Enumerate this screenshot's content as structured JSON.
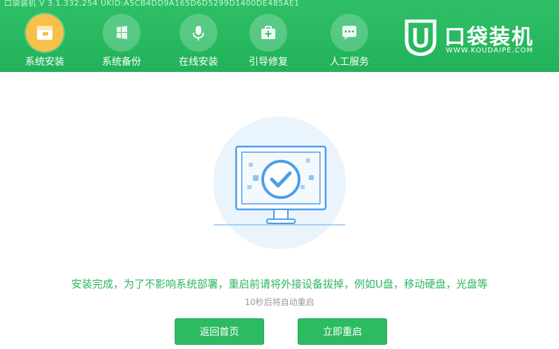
{
  "window": {
    "title": "口袋装机 V 3.1.332.254 UKID:A5CB4DD9A165D6D5299D1400DE485AE1"
  },
  "nav": {
    "items": [
      {
        "label": "系统安装",
        "icon": "system-install-icon",
        "active": true
      },
      {
        "label": "系统备份",
        "icon": "backup-icon",
        "active": false
      },
      {
        "label": "在线安装",
        "icon": "microphone-icon",
        "active": false
      },
      {
        "label": "引导修复",
        "icon": "medical-kit-icon",
        "active": false
      },
      {
        "label": "人工服务",
        "icon": "chat-bubble-icon",
        "active": false
      }
    ]
  },
  "brand": {
    "name": "口袋装机",
    "url": "WWW.KOUDAIPE.COM"
  },
  "colors": {
    "primary": "#2dbb62",
    "active_nav": "#f7c04a",
    "illustration": "#4a9ee8"
  },
  "status": {
    "message": "安装完成，为了不影响系统部署，重启前请将外接设备拔掉，例如U盘，移动硬盘，光盘等",
    "countdown": "10秒后将自动重启"
  },
  "buttons": {
    "back_label": "返回首页",
    "restart_label": "立即重启"
  }
}
